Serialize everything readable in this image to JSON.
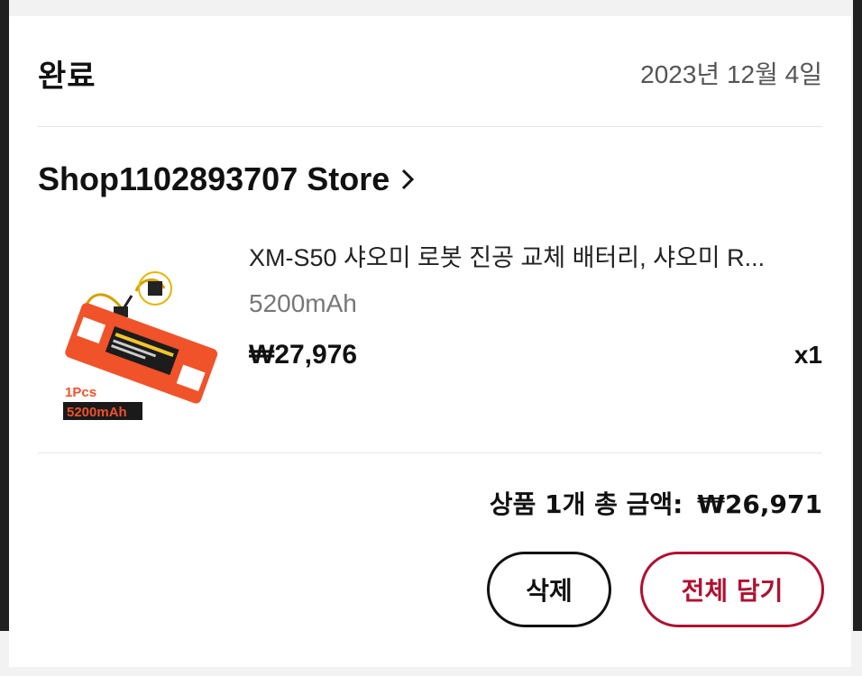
{
  "order": {
    "status": "완료",
    "date": "2023년 12월 4일"
  },
  "store": {
    "name": "Shop1102893707 Store"
  },
  "product": {
    "title": "XM-S50 샤오미 로봇 진공 교체 배터리, 샤오미 R...",
    "variant": "5200mAh",
    "price": "₩27,976",
    "quantity": "x1",
    "image_badge_top": "1Pcs",
    "image_badge_bottom": "5200mAh"
  },
  "summary": {
    "label": "상품 1개 총 금액:",
    "amount": "₩26,971"
  },
  "actions": {
    "delete_label": "삭제",
    "add_all_label": "전체 담기"
  },
  "colors": {
    "accent": "#b01030",
    "battery": "#f0522a"
  }
}
